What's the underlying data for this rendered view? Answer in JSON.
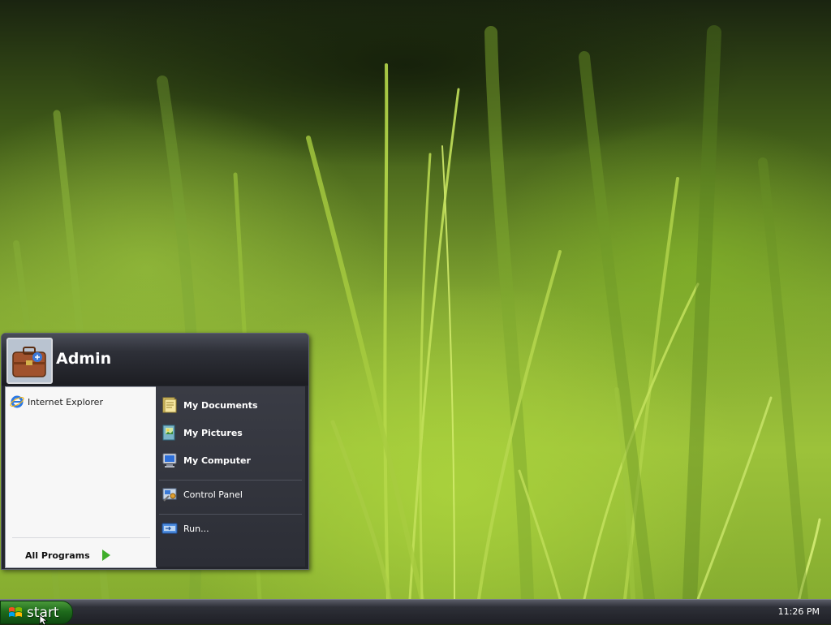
{
  "user": {
    "name": "Admin"
  },
  "start_menu": {
    "pinned": [
      {
        "label": "Internet Explorer",
        "icon": "internet-explorer-icon"
      }
    ],
    "all_programs_label": "All Programs",
    "places": [
      {
        "label": "My Documents",
        "icon": "my-documents-icon"
      },
      {
        "label": "My Pictures",
        "icon": "my-pictures-icon"
      },
      {
        "label": "My Computer",
        "icon": "my-computer-icon"
      }
    ],
    "system": [
      {
        "label": "Control Panel",
        "icon": "control-panel-icon"
      },
      {
        "label": "Run...",
        "icon": "run-icon"
      }
    ]
  },
  "taskbar": {
    "start_label": "start",
    "clock": "11:26 PM"
  },
  "colors": {
    "menu_dark": "#24262d",
    "start_green": "#2a7a24",
    "all_programs_arrow": "#3fae2a"
  }
}
